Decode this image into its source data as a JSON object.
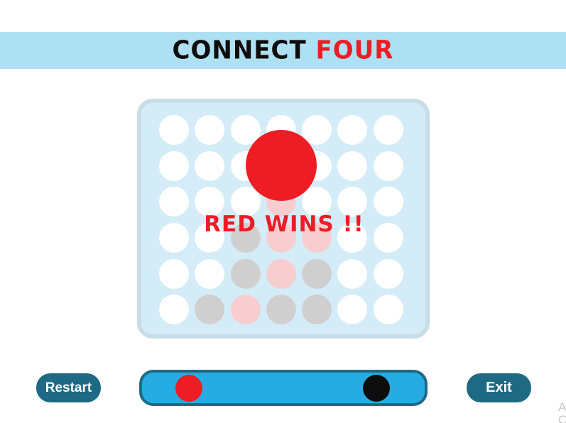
{
  "header": {
    "title_part1": "CONNECT ",
    "title_part2": "FOUR"
  },
  "board": {
    "rows": 6,
    "columns": 7,
    "cells": [
      [
        "empty",
        "empty",
        "empty",
        "empty",
        "empty",
        "empty",
        "empty"
      ],
      [
        "empty",
        "empty",
        "empty",
        "empty",
        "empty",
        "empty",
        "empty"
      ],
      [
        "empty",
        "empty",
        "empty",
        "red",
        "empty",
        "empty",
        "empty"
      ],
      [
        "empty",
        "empty",
        "black",
        "red",
        "red",
        "empty",
        "empty"
      ],
      [
        "empty",
        "empty",
        "black",
        "red",
        "black",
        "empty",
        "empty"
      ],
      [
        "empty",
        "black",
        "red",
        "black",
        "black",
        "empty",
        "empty"
      ]
    ]
  },
  "result": {
    "winner_color": "red",
    "message": "RED WINS !!"
  },
  "controls": {
    "restart_label": "Restart",
    "exit_label": "Exit"
  },
  "turn_indicator": {
    "left_disc": "red",
    "right_disc": "black"
  },
  "corner_text": "A\nC",
  "colors": {
    "red": "#ee1c25",
    "black": "#0d0d0d",
    "header_bg": "#aee0f3",
    "board_bg": "#d4ecf7",
    "button_bg": "#1e6a84",
    "track_bg": "#26abe2"
  }
}
